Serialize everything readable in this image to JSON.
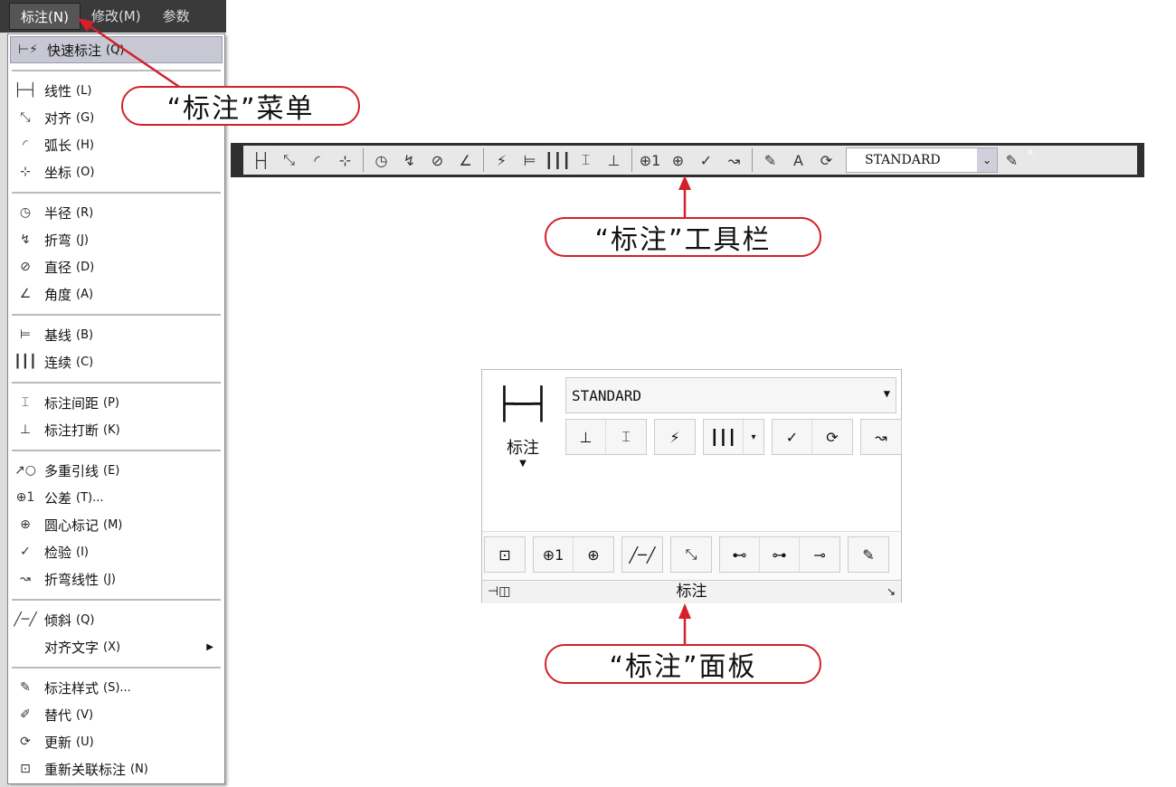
{
  "menubar": {
    "items": [
      "标注(N)",
      "修改(M)",
      "参数"
    ]
  },
  "menu": {
    "groups": [
      [
        {
          "icon": "quick-dimension-icon",
          "glyph": "⊢⚡",
          "label": "快速标注",
          "accel": "(Q)",
          "hl": true
        }
      ],
      [
        {
          "icon": "linear-icon",
          "glyph": "├─┤",
          "label": "线性",
          "accel": "(L)"
        },
        {
          "icon": "aligned-icon",
          "glyph": "⤡",
          "label": "对齐",
          "accel": "(G)"
        },
        {
          "icon": "arc-length-icon",
          "glyph": "◜",
          "label": "弧长",
          "accel": "(H)"
        },
        {
          "icon": "ordinate-icon",
          "glyph": "⊹",
          "label": "坐标",
          "accel": "(O)"
        }
      ],
      [
        {
          "icon": "radius-icon",
          "glyph": "◷",
          "label": "半径",
          "accel": "(R)"
        },
        {
          "icon": "jogged-icon",
          "glyph": "↯",
          "label": "折弯",
          "accel": "(J)"
        },
        {
          "icon": "diameter-icon",
          "glyph": "⊘",
          "label": "直径",
          "accel": "(D)"
        },
        {
          "icon": "angular-icon",
          "glyph": "∠",
          "label": "角度",
          "accel": "(A)"
        }
      ],
      [
        {
          "icon": "baseline-icon",
          "glyph": "⊨",
          "label": "基线",
          "accel": "(B)"
        },
        {
          "icon": "continue-icon",
          "glyph": "┃┃┃",
          "label": "连续",
          "accel": "(C)"
        }
      ],
      [
        {
          "icon": "dimension-space-icon",
          "glyph": "⌶",
          "label": "标注间距",
          "accel": "(P)"
        },
        {
          "icon": "dimension-break-icon",
          "glyph": "⊥",
          "label": "标注打断",
          "accel": "(K)"
        }
      ],
      [
        {
          "icon": "multileader-icon",
          "glyph": "↗○",
          "label": "多重引线",
          "accel": "(E)"
        },
        {
          "icon": "tolerance-icon",
          "glyph": "⊕1",
          "label": "公差",
          "accel": "(T)..."
        },
        {
          "icon": "center-mark-icon",
          "glyph": "⊕",
          "label": "圆心标记",
          "accel": "(M)"
        },
        {
          "icon": "inspection-icon",
          "glyph": "✓",
          "label": "检验",
          "accel": "(I)"
        },
        {
          "icon": "jogged-linear-icon",
          "glyph": "↝",
          "label": "折弯线性",
          "accel": "(J)"
        }
      ],
      [
        {
          "icon": "oblique-icon",
          "glyph": "╱─╱",
          "label": "倾斜",
          "accel": "(Q)"
        },
        {
          "icon": "",
          "glyph": "",
          "label": "对齐文字",
          "accel": "(X)",
          "submenu": true
        }
      ],
      [
        {
          "icon": "dimension-style-icon",
          "glyph": "✎",
          "label": "标注样式",
          "accel": "(S)..."
        },
        {
          "icon": "override-icon",
          "glyph": "✐",
          "label": "替代",
          "accel": "(V)"
        },
        {
          "icon": "update-icon",
          "glyph": "⟳",
          "label": "更新",
          "accel": "(U)"
        },
        {
          "icon": "reassociate-icon",
          "glyph": "⊡",
          "label": "重新关联标注",
          "accel": "(N)"
        }
      ]
    ]
  },
  "toolbar": {
    "style": "STANDARD",
    "buttons": [
      [
        "├┤",
        "⤡",
        "◜",
        "⊹"
      ],
      [
        "◷",
        "↯",
        "⊘",
        "∠"
      ],
      [
        "⚡",
        "⊨",
        "┃┃┃",
        "⌶",
        "⊥"
      ],
      [
        "⊕1",
        "⊕",
        "✓",
        "↝"
      ],
      [
        "✎",
        "A",
        "⟳"
      ]
    ]
  },
  "panel": {
    "title": "标注",
    "big_label": "标注",
    "style": "STANDARD",
    "row1": [
      [
        "⊥",
        "⌶"
      ],
      [
        "⚡"
      ],
      [
        "┃┃┃",
        "▾"
      ],
      [
        "✓",
        "⟳"
      ],
      [
        "↝"
      ]
    ],
    "row2": [
      [
        "⊡"
      ],
      [
        "⊕1",
        "⊕"
      ],
      [
        "╱─╱"
      ],
      [
        "⤡"
      ],
      [
        "⊷",
        "⊶",
        "⊸"
      ],
      [
        "✎"
      ]
    ]
  },
  "callouts": {
    "menu": "“标注”菜单",
    "toolbar": "“标注”工具栏",
    "panel": "“标注”面板"
  },
  "colors": {
    "accent": "#d4202a"
  }
}
